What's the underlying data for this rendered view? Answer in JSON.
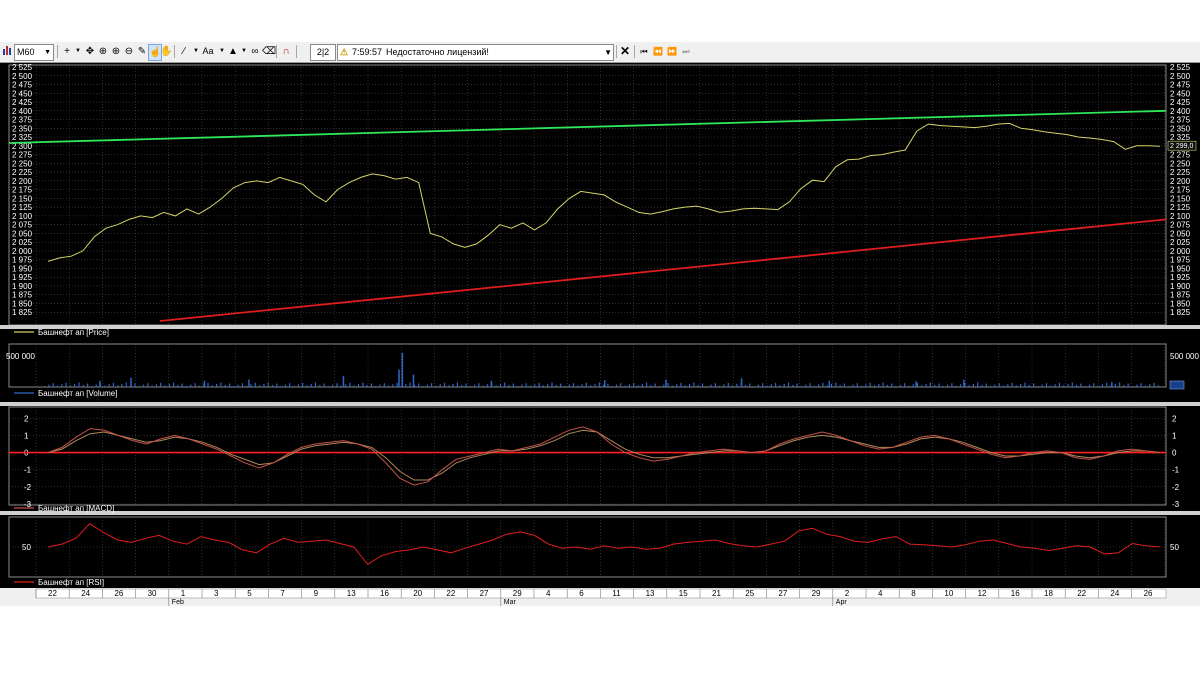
{
  "toolbar": {
    "timeframe": "M60",
    "zoom": "2|2",
    "time": "7:59:57",
    "message": "Недостаточно лицензий!",
    "font_label": "Aa"
  },
  "instrument": "Башнефт ап",
  "panels": {
    "price": {
      "legend": "Башнефт ап [Price]",
      "ylim": [
        1800,
        2525
      ],
      "ticks": [
        "2 525",
        "2 500",
        "2 475",
        "2 450",
        "2 425",
        "2 400",
        "2 375",
        "2 350",
        "2 325",
        "2 300",
        "2 275",
        "2 250",
        "2 225",
        "2 200",
        "2 175",
        "2 150",
        "2 125",
        "2 100",
        "2 075",
        "2 050",
        "2 025",
        "2 000",
        "1 975",
        "1 950",
        "1 925",
        "1 900",
        "1 875",
        "1 850",
        "1 825"
      ],
      "last_price_label": "2 299,0",
      "last_price": 2299
    },
    "volume": {
      "legend": "Башнефт ап [Volume]",
      "tick_left": "500 000",
      "tick_right": "500 000",
      "tick_value": 500000
    },
    "macd": {
      "legend": "Башнефт ап [MACD]",
      "ylim": [
        -3,
        2.6
      ],
      "ticks": [
        "2",
        "1",
        "0",
        "-1",
        "-2",
        "-3"
      ]
    },
    "rsi": {
      "legend": "Башнефт ап [RSI]",
      "ylim": [
        0,
        100
      ],
      "tick": "50"
    }
  },
  "colors": {
    "background": "#000000",
    "price_line": "#d4d46a",
    "support_line": "#e01c1c",
    "resistance_line": "#2ee85a",
    "volume_bars": "#2f68c8",
    "macd_line": "#c4524a",
    "macd_signal": "#b08a5a",
    "rsi_line": "#e11d1d",
    "zero_line": "#ff1f1f",
    "grid": "#5a5a5a"
  },
  "time_axis": {
    "dates": [
      "22",
      "24",
      "26",
      "30",
      "1",
      "3",
      "5",
      "7",
      "9",
      "13",
      "16",
      "20",
      "22",
      "27",
      "29",
      "4",
      "6",
      "11",
      "13",
      "15",
      "21",
      "25",
      "27",
      "29",
      "2",
      "4",
      "8",
      "10",
      "12",
      "16",
      "18",
      "22",
      "24",
      "26"
    ],
    "months": [
      {
        "label": "Feb",
        "before_date_index": 4
      },
      {
        "label": "Mar",
        "before_date_index": 14
      },
      {
        "label": "Apr",
        "before_date_index": 24
      }
    ]
  },
  "chart_data": [
    {
      "type": "line",
      "title": "Башнефт ап [Price]",
      "ylim": [
        1800,
        2525
      ],
      "series": [
        {
          "name": "Башнефт ап [Price]",
          "values": [
            1970,
            1980,
            1985,
            2000,
            2040,
            2065,
            2075,
            2090,
            2100,
            2095,
            2110,
            2100,
            2120,
            2105,
            2125,
            2150,
            2180,
            2195,
            2200,
            2195,
            2210,
            2200,
            2190,
            2160,
            2140,
            2175,
            2195,
            2210,
            2220,
            2215,
            2205,
            2210,
            2195,
            2050,
            2040,
            2020,
            2010,
            2020,
            2045,
            2075,
            2065,
            2080,
            2060,
            2080,
            2120,
            2150,
            2170,
            2165,
            2160,
            2140,
            2125,
            2110,
            2105,
            2112,
            2120,
            2125,
            2128,
            2120,
            2110,
            2114,
            2120,
            2122,
            2120,
            2118,
            2140,
            2178,
            2202,
            2198,
            2240,
            2260,
            2262,
            2272,
            2275,
            2282,
            2288,
            2342,
            2362,
            2358,
            2356,
            2354,
            2352,
            2356,
            2362,
            2364,
            2350,
            2346,
            2340,
            2336,
            2332,
            2325,
            2322,
            2318,
            2312,
            2290,
            2300,
            2300,
            2299
          ]
        }
      ],
      "trendlines": [
        {
          "name": "support",
          "from": 1800,
          "to": 2090
        },
        {
          "name": "resistance",
          "from": 2308,
          "to": 2400
        }
      ]
    },
    {
      "type": "bar",
      "title": "Башнефт ап [Volume]",
      "series": [
        {
          "name": "Башнефт ап [Volume]",
          "spikes": [
            {
              "pos": 0.046,
              "value": 100000
            },
            {
              "pos": 0.074,
              "value": 150000
            },
            {
              "pos": 0.14,
              "value": 100000
            },
            {
              "pos": 0.18,
              "value": 120000
            },
            {
              "pos": 0.265,
              "value": 180000
            },
            {
              "pos": 0.315,
              "value": 280000
            },
            {
              "pos": 0.318,
              "value": 550000
            },
            {
              "pos": 0.328,
              "value": 200000
            },
            {
              "pos": 0.398,
              "value": 100000
            },
            {
              "pos": 0.5,
              "value": 110000
            },
            {
              "pos": 0.555,
              "value": 120000
            },
            {
              "pos": 0.623,
              "value": 140000
            },
            {
              "pos": 0.702,
              "value": 100000
            },
            {
              "pos": 0.78,
              "value": 90000
            },
            {
              "pos": 0.823,
              "value": 120000
            },
            {
              "pos": 0.956,
              "value": 80000
            }
          ]
        }
      ]
    },
    {
      "type": "line",
      "title": "Башнефт ап [MACD]",
      "ylim": [
        -3,
        2.6
      ],
      "series": [
        {
          "name": "MACD",
          "values": [
            0,
            0.3,
            0.9,
            1.4,
            1.3,
            1.0,
            0.7,
            0.5,
            0.8,
            1.0,
            0.8,
            0.5,
            0.2,
            -0.2,
            -0.6,
            -0.9,
            -0.6,
            -0.1,
            0.3,
            0.5,
            0.6,
            0.7,
            0.5,
            0.2,
            -0.6,
            -1.5,
            -1.9,
            -1.7,
            -1.0,
            -0.4,
            -0.2,
            0.0,
            0.2,
            0.1,
            0.3,
            0.5,
            0.9,
            1.3,
            1.5,
            1.2,
            0.5,
            0.0,
            -0.3,
            -0.5,
            -0.4,
            -0.2,
            0.0,
            0.1,
            0.2,
            0.1,
            0.0,
            0.1,
            0.5,
            0.8,
            1.0,
            1.2,
            1.0,
            0.7,
            0.4,
            0.2,
            0.3,
            0.6,
            0.9,
            1.0,
            0.8,
            0.5,
            0.2,
            -0.1,
            -0.3,
            -0.2,
            0.0,
            0.1,
            0.0,
            -0.3,
            -0.4,
            -0.2,
            0.1,
            0.2,
            0.1,
            0.0
          ]
        },
        {
          "name": "Signal",
          "values": [
            0,
            0.2,
            0.7,
            1.1,
            1.2,
            1.0,
            0.8,
            0.6,
            0.7,
            0.9,
            0.8,
            0.6,
            0.3,
            -0.1,
            -0.4,
            -0.7,
            -0.6,
            -0.2,
            0.2,
            0.4,
            0.5,
            0.6,
            0.5,
            0.3,
            -0.3,
            -1.1,
            -1.6,
            -1.6,
            -1.2,
            -0.6,
            -0.3,
            -0.1,
            0.1,
            0.1,
            0.2,
            0.4,
            0.7,
            1.1,
            1.3,
            1.2,
            0.7,
            0.2,
            -0.1,
            -0.3,
            -0.3,
            -0.2,
            -0.1,
            0.0,
            0.1,
            0.1,
            0.0,
            0.1,
            0.4,
            0.7,
            0.9,
            1.0,
            0.9,
            0.7,
            0.5,
            0.3,
            0.3,
            0.5,
            0.8,
            0.9,
            0.8,
            0.6,
            0.3,
            0.0,
            -0.2,
            -0.2,
            -0.1,
            0.0,
            0.0,
            -0.2,
            -0.3,
            -0.2,
            0.0,
            0.1,
            0.1,
            0.0
          ]
        }
      ]
    },
    {
      "type": "line",
      "title": "Башнефт ап [RSI]",
      "ylim": [
        0,
        100
      ],
      "series": [
        {
          "name": "Башнефт ап [RSI]",
          "values": [
            50,
            55,
            65,
            90,
            75,
            62,
            58,
            65,
            70,
            60,
            55,
            68,
            62,
            58,
            45,
            40,
            55,
            65,
            58,
            60,
            62,
            56,
            50,
            20,
            35,
            42,
            45,
            50,
            45,
            40,
            48,
            55,
            62,
            72,
            76,
            70,
            55,
            48,
            50,
            46,
            52,
            48,
            50,
            46,
            48,
            55,
            58,
            60,
            62,
            56,
            52,
            50,
            55,
            60,
            78,
            82,
            72,
            68,
            60,
            58,
            64,
            68,
            55,
            54,
            52,
            50,
            54,
            60,
            62,
            56,
            50,
            48,
            44,
            48,
            52,
            50,
            38,
            40,
            56,
            52,
            50
          ]
        }
      ]
    }
  ]
}
